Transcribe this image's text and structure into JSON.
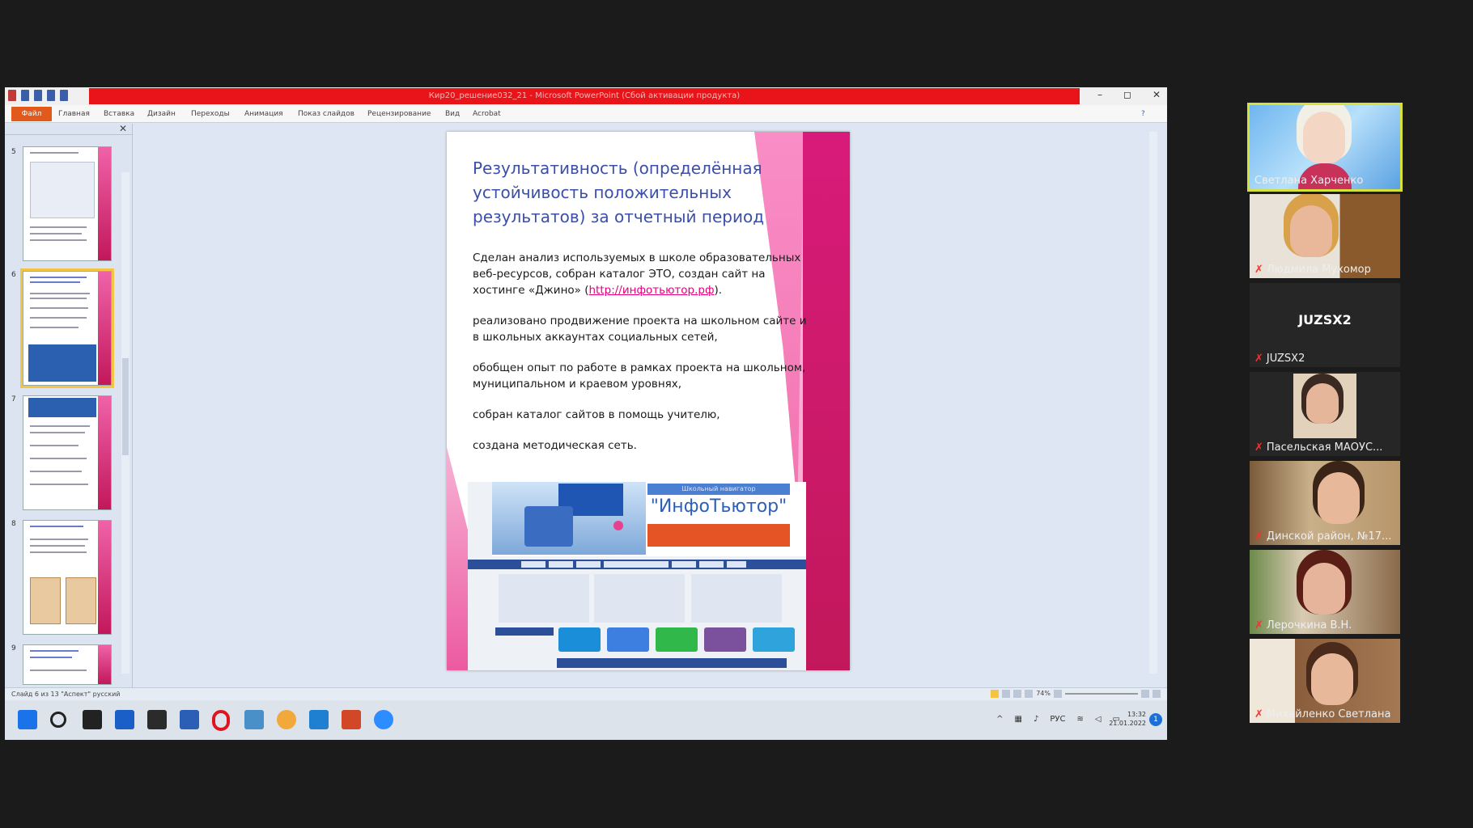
{
  "window": {
    "title": "Кир20_решение032_21 - Microsoft PowerPoint (Сбой активации продукта)",
    "controls": [
      "–",
      "◻",
      "✕"
    ]
  },
  "ribbon": {
    "file": "Файл",
    "tabs": [
      "Главная",
      "Вставка",
      "Дизайн",
      "Переходы",
      "Анимация",
      "Показ слайдов",
      "Рецензирование",
      "Вид",
      "Acrobat"
    ]
  },
  "thumbnails": {
    "numbers": [
      "5",
      "6",
      "7",
      "8",
      "9"
    ],
    "selected": 1
  },
  "slide": {
    "title": "Результативность (определённая устойчивость положительных результатов) за отчетный период",
    "p1_text": "Сделан анализ используемых в школе образовательных веб-ресурсов, собран каталог ЭТО, создан сайт на хостинге «Джино» (",
    "p1_link": "http://инфотьютор.рф",
    "p1_end": ").",
    "p2": "реализовано продвижение проекта на школьном сайте и в школьных аккаунтах социальных сетей,",
    "p3": "обобщен опыт по работе в рамках проекта на школьном, муниципальном и краевом уровнях,",
    "p4": "собран каталог сайтов в помощь учителю,",
    "p5": "создана методическая сеть.",
    "screenshot": {
      "brand_top": "Школьный навигатор",
      "brand_name": "\"ИнфоТьютор\""
    }
  },
  "statusbar": {
    "left": "Слайд 6 из 13   \"Аспект\"   русский",
    "zoom": "74%"
  },
  "taskbar": {
    "tray_lang": "РУС",
    "time": "13:32",
    "date": "21.01.2022",
    "notifications": "1"
  },
  "participants": [
    {
      "name": "Светлана Харченко",
      "active": true
    },
    {
      "name": "Людмила Мухомор",
      "muted": true
    },
    {
      "name": "JUZSX2",
      "label": "JUZSX2",
      "muted": true
    },
    {
      "name": "Пасельская МАОУС...",
      "muted": true
    },
    {
      "name": "Динской район, №17...",
      "muted": true
    },
    {
      "name": "Лерочкина В.Н.",
      "muted": true
    },
    {
      "name": "Михайленко Светлана",
      "muted": true
    }
  ],
  "colors": {
    "accent_red": "#e8141a",
    "slide_title": "#3b4fa8",
    "pink": "#c2185b",
    "active_tile": "#d6e23a"
  }
}
